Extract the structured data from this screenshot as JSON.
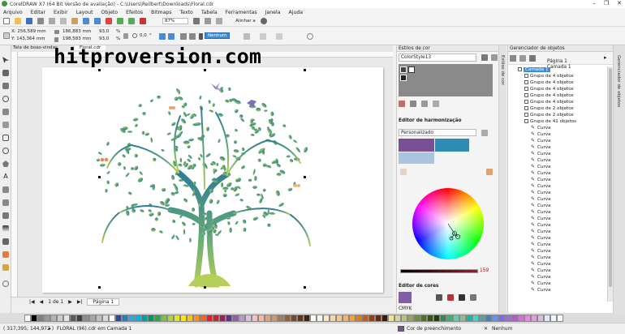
{
  "window": {
    "title": "CorelDRAW X7 (64 Bit Versão de avaliação) - C:\\Users\\Reilbert\\Downloads\\Floral.cdr",
    "controls": [
      "–",
      "❐",
      "✕"
    ]
  },
  "menu": [
    "Arquivo",
    "Editar",
    "Exibir",
    "Layout",
    "Objeto",
    "Efeitos",
    "Bitmaps",
    "Texto",
    "Tabela",
    "Ferramentas",
    "Janela",
    "Ajuda"
  ],
  "toolbar": {
    "zoom": "87%",
    "snap_label": "Alinhar a",
    "x": "X: 256,589 mm",
    "y": "Y: 143,364 mm",
    "w": "186,883 mm",
    "h": "198,583 mm",
    "scale_w": "93,0",
    "scale_h": "93,0",
    "pct": "%",
    "rotation": "0,0",
    "rotation_unit": "°",
    "outline": "Nenhum"
  },
  "document": {
    "tab_label": "Tela de boas-vindas",
    "filename_tab": "Floral.cdr",
    "page_counter": "1 de 1",
    "page_tab": "Página 1"
  },
  "watermark": "hitproversion.com",
  "color_styles": {
    "panel_title": "Estilos de cor",
    "style_name": "ColorStyle13",
    "harmony_title": "Editor de harmonização",
    "harmony_mode": "Personalizado",
    "harmony_colors": [
      "#7b4f96",
      "#2e8bb3",
      "#a9c4dc"
    ],
    "brightness": "159",
    "color_editor_title": "Editor de cores",
    "color_model": "CMYK",
    "selected_color": "#8060a4"
  },
  "vtabs": [
    "Estilos de cor",
    "Gerenciador de objetos"
  ],
  "object_manager": {
    "panel_title": "Gerenciador de objetos",
    "page": "Página 1",
    "layer": "Camada 1",
    "rows": [
      {
        "label": "Camada 1",
        "type": "layer",
        "indent": 1
      },
      {
        "label": "Grupo de 4 objetos",
        "type": "group",
        "indent": 2
      },
      {
        "label": "Grupo de 4 objetos",
        "type": "group",
        "indent": 2
      },
      {
        "label": "Grupo de 4 objetos",
        "type": "group",
        "indent": 2
      },
      {
        "label": "Grupo de 4 objetos",
        "type": "group",
        "indent": 2
      },
      {
        "label": "Grupo de 4 objetos",
        "type": "group",
        "indent": 2
      },
      {
        "label": "Grupo de 2 objetos",
        "type": "group",
        "indent": 2
      },
      {
        "label": "Grupo de 2 objetos",
        "type": "group",
        "indent": 2
      },
      {
        "label": "Grupo de 41 objetos",
        "type": "group",
        "indent": 2
      },
      {
        "label": "Curva",
        "type": "curve",
        "indent": 3
      },
      {
        "label": "Curva",
        "type": "curve",
        "indent": 3
      },
      {
        "label": "Curva",
        "type": "curve",
        "indent": 3
      },
      {
        "label": "Curva",
        "type": "curve",
        "indent": 3
      },
      {
        "label": "Curva",
        "type": "curve",
        "indent": 3
      },
      {
        "label": "Curva",
        "type": "curve",
        "indent": 3
      },
      {
        "label": "Curva",
        "type": "curve",
        "indent": 3
      },
      {
        "label": "Curva",
        "type": "curve",
        "indent": 3
      },
      {
        "label": "Curva",
        "type": "curve",
        "indent": 3
      },
      {
        "label": "Curva",
        "type": "curve",
        "indent": 3
      },
      {
        "label": "Curva",
        "type": "curve",
        "indent": 3
      },
      {
        "label": "Curva",
        "type": "curve",
        "indent": 3
      },
      {
        "label": "Curva",
        "type": "curve",
        "indent": 3
      },
      {
        "label": "Curva",
        "type": "curve",
        "indent": 3
      },
      {
        "label": "Curva",
        "type": "curve",
        "indent": 3
      },
      {
        "label": "Curva",
        "type": "curve",
        "indent": 3
      },
      {
        "label": "Curva",
        "type": "curve",
        "indent": 3
      },
      {
        "label": "Curva",
        "type": "curve",
        "indent": 3
      },
      {
        "label": "Curva",
        "type": "curve",
        "indent": 3
      },
      {
        "label": "Curva",
        "type": "curve",
        "indent": 3
      },
      {
        "label": "Curva",
        "type": "curve",
        "indent": 3
      },
      {
        "label": "Curva",
        "type": "curve",
        "indent": 3
      },
      {
        "label": "Curva",
        "type": "curve",
        "indent": 3
      },
      {
        "label": "Curva",
        "type": "curve",
        "indent": 3
      },
      {
        "label": "Curva",
        "type": "curve",
        "indent": 3
      },
      {
        "label": "Curva",
        "type": "curve",
        "indent": 3
      }
    ]
  },
  "palette": [
    "#ffffff",
    "#000000",
    "#7f7f7f",
    "#999999",
    "#b2b2b2",
    "#cccccc",
    "#e5e5e5",
    "#5b5b5b",
    "#403f3f",
    "#8c8c8c",
    "#a6a6a6",
    "#bfbfbf",
    "#d9d9d9",
    "#ffffff",
    "#2a4b9b",
    "#1f7fc1",
    "#33a6d9",
    "#00b3e6",
    "#00a0a0",
    "#00985f",
    "#28a745",
    "#7cc242",
    "#b5d334",
    "#e6e619",
    "#ffe600",
    "#ffc20e",
    "#f7941d",
    "#f26522",
    "#ed1c24",
    "#c1272d",
    "#9e1f63",
    "#662d91",
    "#8e5fa8",
    "#b59bc6",
    "#d9c2e0",
    "#f4c2c2",
    "#f7b7a3",
    "#e3a278",
    "#c69c6d",
    "#a67c52",
    "#8c6239",
    "#754c24",
    "#603913",
    "#3c2415",
    "#ffffff",
    "#fef4e8",
    "#fde5c7",
    "#fcd5a3",
    "#f9c785",
    "#f7b460",
    "#f59e32",
    "#e07b1f",
    "#c95b1a",
    "#9b3c13",
    "#6b2a0e",
    "#3f1907",
    "#f0e68c",
    "#d4d49a",
    "#b8c27a",
    "#93a857",
    "#6f8f3a",
    "#4e7320",
    "#335a12",
    "#1f4009",
    "#2e8b57",
    "#3cb371",
    "#66cdaa",
    "#8fbc8f",
    "#20b2aa",
    "#48d1cc",
    "#5f9ea0",
    "#4682b4",
    "#6495ed",
    "#7b68ee",
    "#9370db",
    "#ba55d3",
    "#da70d6",
    "#ee82ee",
    "#dda0dd",
    "#d8bfd8",
    "#e6e6fa",
    "#f0f8ff",
    "#fffafa"
  ],
  "status": {
    "coords": "( 317,395; 144,972 )",
    "info": "FLORAL (96).cdr em Camada 1",
    "fill_label": "Cor de preenchimento",
    "outline_label": "Nenhum"
  },
  "colors": {
    "accent_blue": "#3c8ed8",
    "trunk": "#a8c060",
    "leaf_top": "#2f7d96",
    "leaf_bottom": "#9ac24a"
  }
}
